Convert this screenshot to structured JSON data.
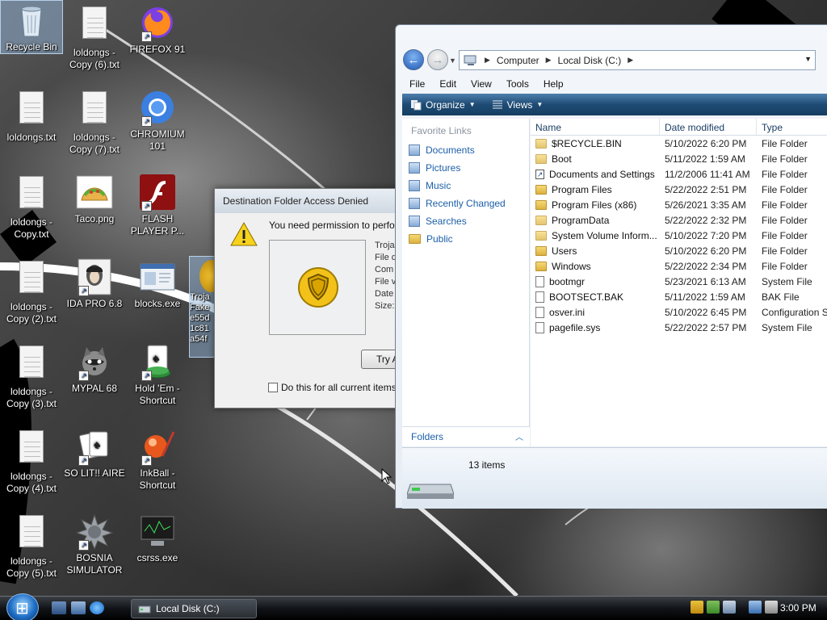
{
  "desktop": {
    "icons": [
      {
        "label": "Recycle Bin"
      },
      {
        "label": "loldongs - Copy (6).txt"
      },
      {
        "label": "FIREFOX 91"
      },
      {
        "label": "loldongs.txt"
      },
      {
        "label": "loldongs - Copy (7).txt"
      },
      {
        "label": "CHROMIUM 101"
      },
      {
        "label": "loldongs - Copy.txt"
      },
      {
        "label": "Taco.png"
      },
      {
        "label": "FLASH PLAYER P..."
      },
      {
        "label": "loldongs - Copy (2).txt"
      },
      {
        "label": "IDA PRO 6.8"
      },
      {
        "label": "blocks.exe"
      },
      {
        "label": "loldongs - Copy (3).txt"
      },
      {
        "label": "MYPAL 68"
      },
      {
        "label": "Hold 'Em - Shortcut"
      },
      {
        "label": "loldongs - Copy (4).txt"
      },
      {
        "label": "SO LIT!! AIRE"
      },
      {
        "label": "InkBall - Shortcut"
      },
      {
        "label": "loldongs - Copy (5).txt"
      },
      {
        "label": "BOSNIA SIMULATOR"
      },
      {
        "label": "csrss.exe"
      }
    ],
    "selected_partial_label": "Troja\nFake\ne55d\n1c81\na54f"
  },
  "dialog": {
    "title": "Destination Folder Access Denied",
    "message": "You need permission to perfo",
    "meta_lines": [
      "Troja",
      "File d",
      "Com",
      "File v",
      "Date",
      "Size:"
    ],
    "try_again_label": "Try A",
    "checkbox_label": "Do this for all current items"
  },
  "explorer": {
    "breadcrumb": [
      "Computer",
      "Local Disk (C:)"
    ],
    "menu": [
      "File",
      "Edit",
      "View",
      "Tools",
      "Help"
    ],
    "toolbar": {
      "organize": "Organize",
      "views": "Views"
    },
    "favorite_links_header": "Favorite Links",
    "favorite_links": [
      "Documents",
      "Pictures",
      "Music",
      "Recently Changed",
      "Searches",
      "Public"
    ],
    "folders_label": "Folders",
    "columns": [
      "Name",
      "Date modified",
      "Type"
    ],
    "files": [
      {
        "name": "$RECYCLE.BIN",
        "date": "5/10/2022 6:20 PM",
        "type": "File Folder",
        "icon": "folder-dim"
      },
      {
        "name": "Boot",
        "date": "5/11/2022 1:59 AM",
        "type": "File Folder",
        "icon": "folder-dim"
      },
      {
        "name": "Documents and Settings",
        "date": "11/2/2006 11:41 AM",
        "type": "File Folder",
        "icon": "link"
      },
      {
        "name": "Program Files",
        "date": "5/22/2022 2:51 PM",
        "type": "File Folder",
        "icon": "folder"
      },
      {
        "name": "Program Files (x86)",
        "date": "5/26/2021 3:35 AM",
        "type": "File Folder",
        "icon": "folder"
      },
      {
        "name": "ProgramData",
        "date": "5/22/2022 2:32 PM",
        "type": "File Folder",
        "icon": "folder-dim"
      },
      {
        "name": "System Volume Inform...",
        "date": "5/10/2022 7:20 PM",
        "type": "File Folder",
        "icon": "folder-dim"
      },
      {
        "name": "Users",
        "date": "5/10/2022 6:20 PM",
        "type": "File Folder",
        "icon": "folder"
      },
      {
        "name": "Windows",
        "date": "5/22/2022 2:34 PM",
        "type": "File Folder",
        "icon": "folder"
      },
      {
        "name": "bootmgr",
        "date": "5/23/2021 6:13 AM",
        "type": "System File",
        "icon": "file"
      },
      {
        "name": "BOOTSECT.BAK",
        "date": "5/11/2022 1:59 AM",
        "type": "BAK File",
        "icon": "file"
      },
      {
        "name": "osver.ini",
        "date": "5/10/2022 6:45 PM",
        "type": "Configuration S",
        "icon": "file"
      },
      {
        "name": "pagefile.sys",
        "date": "5/22/2022 2:57 PM",
        "type": "System File",
        "icon": "file"
      }
    ],
    "item_count": "13 items"
  },
  "taskbar": {
    "window_button": "Local Disk (C:)",
    "clock": "3:00 PM"
  },
  "colors": {
    "toolbar": "#1e4b74",
    "link": "#1c5fa8",
    "accent": "#1f58b5"
  }
}
